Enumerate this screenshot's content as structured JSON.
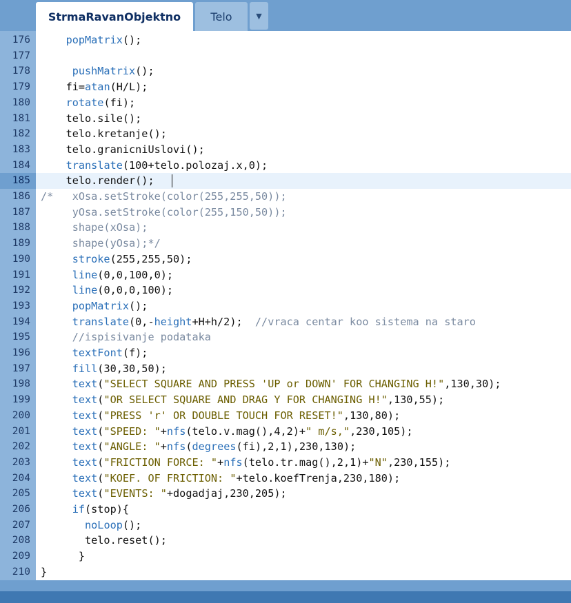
{
  "tabs": {
    "active_label": "StrmaRavanObjektno",
    "inactive_label": "Telo",
    "menu_glyph": "▼"
  },
  "editor": {
    "current_line": 185,
    "lines": [
      {
        "n": "176",
        "text": "    popMatrix();"
      },
      {
        "n": "177",
        "text": ""
      },
      {
        "n": "178",
        "text": "     pushMatrix();"
      },
      {
        "n": "179",
        "text": "    fi=atan(H/L);"
      },
      {
        "n": "180",
        "text": "    rotate(fi);"
      },
      {
        "n": "181",
        "text": "    telo.sile();"
      },
      {
        "n": "182",
        "text": "    telo.kretanje();"
      },
      {
        "n": "183",
        "text": "    telo.granicniUslovi();"
      },
      {
        "n": "184",
        "text": "    translate(100+telo.polozaj.x,0);"
      },
      {
        "n": "185",
        "text": "    telo.render();"
      },
      {
        "n": "186",
        "text": "/*   xOsa.setStroke(color(255,255,50));"
      },
      {
        "n": "187",
        "text": "     yOsa.setStroke(color(255,150,50));"
      },
      {
        "n": "188",
        "text": "     shape(xOsa);"
      },
      {
        "n": "189",
        "text": "     shape(yOsa);*/"
      },
      {
        "n": "190",
        "text": "     stroke(255,255,50);"
      },
      {
        "n": "191",
        "text": "     line(0,0,100,0);"
      },
      {
        "n": "192",
        "text": "     line(0,0,0,100);"
      },
      {
        "n": "193",
        "text": "     popMatrix();"
      },
      {
        "n": "194",
        "text": "     translate(0,-height+H+h/2);  //vraca centar koo sistema na staro"
      },
      {
        "n": "195",
        "text": "     //ispisivanje podataka"
      },
      {
        "n": "196",
        "text": "     textFont(f);"
      },
      {
        "n": "197",
        "text": "     fill(30,30,50);"
      },
      {
        "n": "198",
        "text": "     text(\"SELECT SQUARE AND PRESS 'UP or DOWN' FOR CHANGING H!\",130,30);"
      },
      {
        "n": "199",
        "text": "     text(\"OR SELECT SQUARE AND DRAG Y FOR CHANGING H!\",130,55);"
      },
      {
        "n": "200",
        "text": "     text(\"PRESS 'r' OR DOUBLE TOUCH FOR RESET!\",130,80);"
      },
      {
        "n": "201",
        "text": "     text(\"SPEED: \"+nfs(telo.v.mag(),4,2)+\" m/s,\",230,105);"
      },
      {
        "n": "202",
        "text": "     text(\"ANGLE: \"+nfs(degrees(fi),2,1),230,130);"
      },
      {
        "n": "203",
        "text": "     text(\"FRICTION FORCE: \"+nfs(telo.tr.mag(),2,1)+\"N\",230,155);"
      },
      {
        "n": "204",
        "text": "     text(\"KOEF. OF FRICTION: \"+telo.koefTrenja,230,180);"
      },
      {
        "n": "205",
        "text": "     text(\"EVENTS: \"+dogadjaj,230,205);"
      },
      {
        "n": "206",
        "text": "     if(stop){"
      },
      {
        "n": "207",
        "text": "       noLoop();"
      },
      {
        "n": "208",
        "text": "       telo.reset();"
      },
      {
        "n": "209",
        "text": "      }"
      },
      {
        "n": "210",
        "text": "}"
      }
    ]
  },
  "colors": {
    "background": "#6f9fcf",
    "gutter": "#8db4db",
    "keyword": "#2a6fb8",
    "comment": "#7a8aa0",
    "string": "#6b5e00",
    "text": "#111111"
  }
}
